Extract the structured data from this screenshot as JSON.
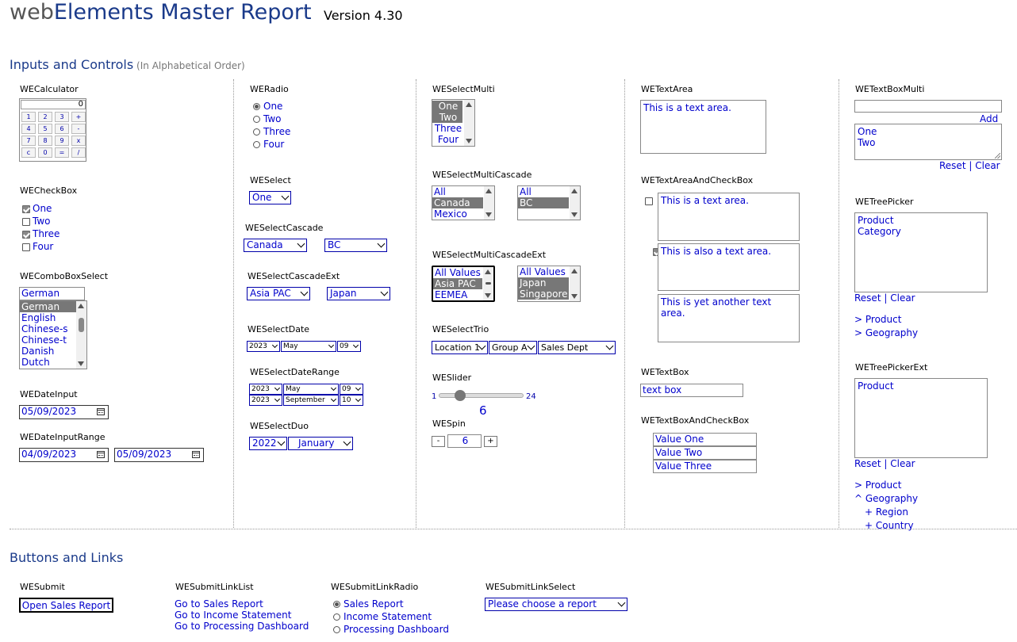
{
  "header": {
    "title_prefix": "web",
    "title_main": "Elements Master Report",
    "version": "Version 4.30"
  },
  "sections": {
    "inputs": "Inputs and Controls",
    "inputs_sub": "(In Alphabetical Order)",
    "buttons": "Buttons and Links"
  },
  "calculator": {
    "label": "WECalculator",
    "display": "0",
    "keys": [
      "1",
      "2",
      "3",
      "+",
      "4",
      "5",
      "6",
      "-",
      "7",
      "8",
      "9",
      "x",
      "c",
      "0",
      "=",
      "/"
    ]
  },
  "checkbox": {
    "label": "WECheckBox",
    "items": [
      {
        "text": "One",
        "checked": true
      },
      {
        "text": "Two",
        "checked": false
      },
      {
        "text": "Three",
        "checked": true
      },
      {
        "text": "Four",
        "checked": false
      }
    ]
  },
  "combobox": {
    "label": "WEComboBoxSelect",
    "value": "German",
    "items": [
      "German",
      "English",
      "Chinese-s",
      "Chinese-t",
      "Danish",
      "Dutch"
    ]
  },
  "dateinput": {
    "label": "WEDateInput",
    "value": "05/09/2023"
  },
  "daterange": {
    "label": "WEDateInputRange",
    "from": "04/09/2023",
    "to": "05/09/2023"
  },
  "radio": {
    "label": "WERadio",
    "items": [
      {
        "text": "One",
        "checked": true
      },
      {
        "text": "Two",
        "checked": false
      },
      {
        "text": "Three",
        "checked": false
      },
      {
        "text": "Four",
        "checked": false
      }
    ]
  },
  "select": {
    "label": "WESelect",
    "value": "One"
  },
  "selectcascade": {
    "label": "WESelectCascade",
    "a": "Canada",
    "b": "BC"
  },
  "selectcascadeext": {
    "label": "WESelectCascadeExt",
    "a": "Asia PAC",
    "b": "Japan"
  },
  "selectdate": {
    "label": "WESelectDate",
    "year": "2023",
    "month": "May",
    "day": "09"
  },
  "selectdaterange": {
    "label": "WESelectDateRange",
    "y1": "2023",
    "m1": "May",
    "d1": "09",
    "y2": "2023",
    "m2": "September",
    "d2": "10"
  },
  "selectduo": {
    "label": "WESelectDuo",
    "a": "2022",
    "b": "January"
  },
  "selectmulti": {
    "label": "WESelectMulti",
    "items": [
      "One",
      "Two",
      "Three",
      "Four"
    ]
  },
  "selectmulticascade": {
    "label": "WESelectMultiCascade",
    "left": [
      "All",
      "Canada",
      "Mexico"
    ],
    "right": [
      "All",
      "BC"
    ]
  },
  "selectmulticascadeext": {
    "label": "WESelectMultiCascadeExt",
    "left": [
      "All Values",
      "Asia PAC",
      "EEMEA"
    ],
    "right": [
      "All Values",
      "Japan",
      "Singapore"
    ]
  },
  "selecttrio": {
    "label": "WESelectTrio",
    "a": "Location 1",
    "b": "Group A",
    "c": "Sales Dept"
  },
  "slider": {
    "label": "WESlider",
    "min": "1",
    "max": "24",
    "value": "6",
    "fraction": 0.217
  },
  "spin": {
    "label": "WESpin",
    "minus": "-",
    "value": "6",
    "plus": "+"
  },
  "textarea": {
    "label": "WETextArea",
    "value": "This is a text area."
  },
  "textareacheck": {
    "label": "WETextAreaAndCheckBox",
    "items": [
      {
        "text": "This is a text area.",
        "checked": false
      },
      {
        "text": "This is also a text area.",
        "checked": true
      },
      {
        "text": "This is yet another text area.",
        "checked": false
      }
    ]
  },
  "textbox": {
    "label": "WETextBox",
    "value": "text box"
  },
  "textboxcheck": {
    "label": "WETextBoxAndCheckBox",
    "items": [
      {
        "text": "Value One",
        "checked": true
      },
      {
        "text": "Value Two",
        "checked": false
      },
      {
        "text": "Value Three",
        "checked": true
      }
    ]
  },
  "textboxmulti": {
    "label": "WETextBoxMulti",
    "add": "Add",
    "items": [
      "One",
      "Two"
    ],
    "reset": "Reset",
    "sep": "|",
    "clear": "Clear"
  },
  "treepicker": {
    "label": "WETreePicker",
    "items": [
      "Product",
      "Category"
    ],
    "reset": "Reset",
    "sep": "|",
    "clear": "Clear",
    "tree": [
      "> Product",
      "> Geography"
    ]
  },
  "treepickerext": {
    "label": "WETreePickerExt",
    "items": [
      "Product"
    ],
    "reset": "Reset",
    "sep": "|",
    "clear": "Clear",
    "tree": [
      "> Product",
      "^ Geography",
      "+ Region",
      "+ Country"
    ]
  },
  "submit": {
    "label": "WESubmit",
    "button": "Open Sales Report"
  },
  "submitlinklist": {
    "label": "WESubmitLinkList",
    "links": [
      "Go to Sales Report",
      "Go to Income Statement",
      "Go to Processing Dashboard"
    ]
  },
  "submitlinkradio": {
    "label": "WESubmitLinkRadio",
    "items": [
      {
        "text": "Sales Report",
        "checked": true
      },
      {
        "text": "Income Statement",
        "checked": false
      },
      {
        "text": "Processing Dashboard",
        "checked": false
      }
    ]
  },
  "submitlinkselect": {
    "label": "WESubmitLinkSelect",
    "value": "Please choose a report"
  }
}
